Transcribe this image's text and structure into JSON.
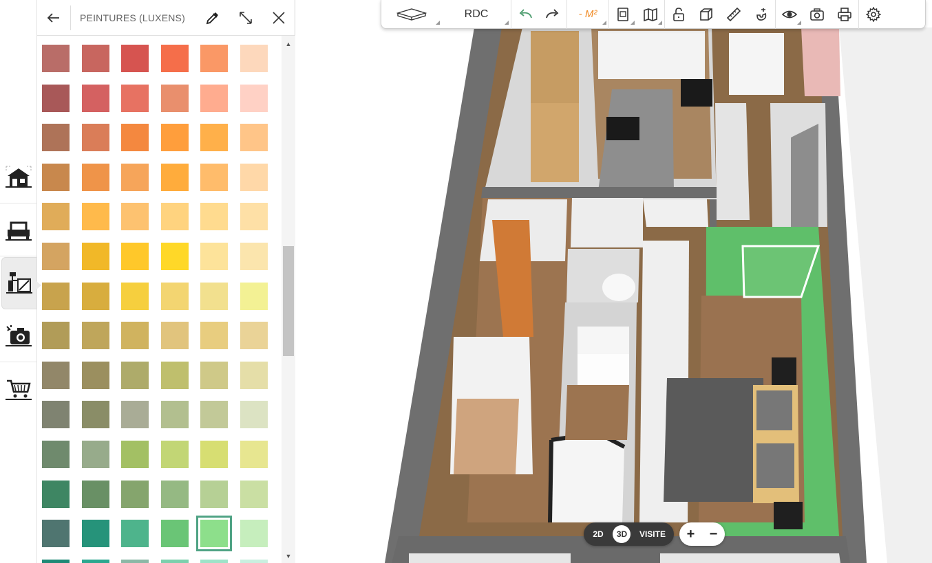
{
  "panel": {
    "title": "PEINTURES (LUXENS)",
    "selected": {
      "row": 12,
      "col": 4
    },
    "swatches": [
      [
        "#b96d68",
        "#c8665f",
        "#d65450",
        "#f56e4a",
        "#fa9866",
        "#fdd8bc"
      ],
      [
        "#a85858",
        "#d46161",
        "#e77262",
        "#e98f6d",
        "#ffac8f",
        "#ffd1c5"
      ],
      [
        "#ae7358",
        "#da7d58",
        "#f4883f",
        "#ff9e3c",
        "#ffb04a",
        "#ffc588"
      ],
      [
        "#c8884d",
        "#ef9449",
        "#f6a55a",
        "#ffac3c",
        "#ffbc6b",
        "#ffd8a8"
      ],
      [
        "#e0ac59",
        "#ffba4b",
        "#fdc270",
        "#ffd37f",
        "#ffdb8f",
        "#fee0a6"
      ],
      [
        "#d4a461",
        "#f1b828",
        "#ffc82a",
        "#ffd828",
        "#fde39a",
        "#fbe5ad"
      ],
      [
        "#c8a34d",
        "#d8ad3e",
        "#f6cf3e",
        "#f3d571",
        "#f2e08e",
        "#f3f194"
      ],
      [
        "#b19c58",
        "#bfa65b",
        "#d0b35f",
        "#e1c47d",
        "#e8cd7f",
        "#ead397"
      ],
      [
        "#928769",
        "#9b8f5f",
        "#aeab6a",
        "#bfbf6d",
        "#cfc988",
        "#e5dea8"
      ],
      [
        "#7f8371",
        "#8a8d67",
        "#a9ac96",
        "#b2bf8f",
        "#c2c998",
        "#dce3c3"
      ],
      [
        "#6f8a6d",
        "#97ab8b",
        "#a3c064",
        "#c2d675",
        "#d7de72",
        "#e7e690"
      ],
      [
        "#3e8663",
        "#699065",
        "#85a56d",
        "#95b983",
        "#b6d095",
        "#cadfa3"
      ],
      [
        "#4f7570",
        "#26937a",
        "#4eb48c",
        "#6ac576",
        "#8ddf8b",
        "#c6eebd"
      ],
      [
        "#1e8a76",
        "#2aa88f",
        "#8bb8a6",
        "#7bd0ad",
        "#9de3c8",
        "#c9efdf"
      ]
    ]
  },
  "toolbar": {
    "level": "RDC",
    "m2_label": "- M²"
  },
  "modes": {
    "two_d": "2D",
    "three_d": "3D",
    "visit": "VISITE"
  },
  "zoom": {
    "plus": "+",
    "minus": "−"
  }
}
